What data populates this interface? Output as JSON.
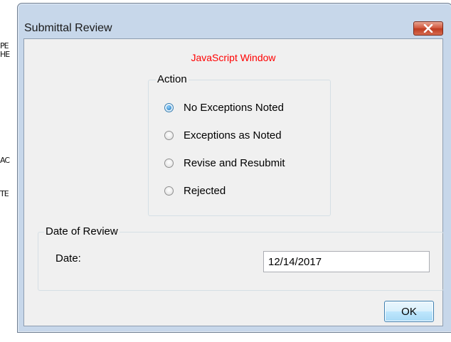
{
  "background_doc": {
    "fragments": [
      "PE",
      "HE",
      "AC",
      "TE"
    ]
  },
  "dialog": {
    "title": "Submittal Review",
    "close_icon": "close-x-icon",
    "note": "JavaScript Window",
    "action_group": {
      "legend": "Action",
      "options": [
        {
          "label": "No Exceptions Noted",
          "checked": true
        },
        {
          "label": "Exceptions as Noted",
          "checked": false
        },
        {
          "label": "Revise and Resubmit",
          "checked": false
        },
        {
          "label": "Rejected",
          "checked": false
        }
      ]
    },
    "date_group": {
      "legend": "Date of Review",
      "date_label": "Date:",
      "date_value": "12/14/2017"
    },
    "ok_label": "OK"
  },
  "colors": {
    "note_text": "#ff0000",
    "close_button": "#c9462c",
    "frame": "#c7d7ea"
  }
}
